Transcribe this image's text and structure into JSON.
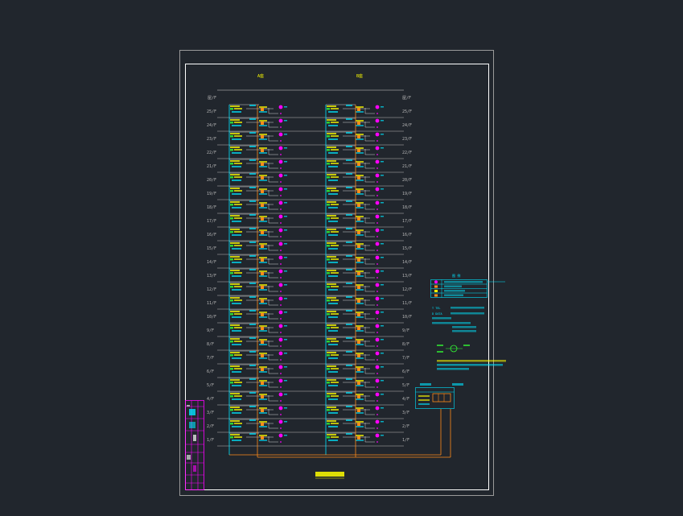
{
  "drawing": {
    "title": "",
    "column_labels": [
      "A座",
      "B座"
    ],
    "roof_label": "屋/F",
    "floors": [
      "25/F",
      "24/F",
      "23/F",
      "22/F",
      "21/F",
      "20/F",
      "19/F",
      "18/F",
      "17/F",
      "16/F",
      "15/F",
      "14/F",
      "13/F",
      "12/F",
      "11/F",
      "10/F",
      "9/F",
      "8/F",
      "7/F",
      "6/F",
      "5/F",
      "4/F",
      "3/F",
      "2/F",
      "1/F"
    ]
  },
  "legend": {
    "heading": "图  例",
    "rows": [
      "",
      "",
      "",
      ""
    ],
    "notes": [
      "T  TEL",
      "D  DATA",
      "",
      ""
    ],
    "colors": {
      "magenta": "#ff00ff",
      "cyan": "#00e5ff",
      "yellow": "#ffff00",
      "orange": "#ff8c1a",
      "green": "#33ff33",
      "frame": "#b0b0b0",
      "white": "#ffffff"
    }
  }
}
